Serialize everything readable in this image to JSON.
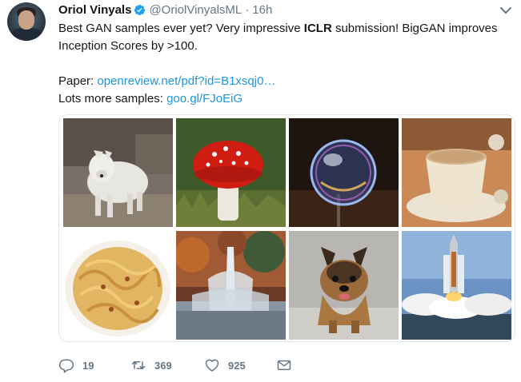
{
  "tweet": {
    "author_name": "Oriol Vinyals",
    "author_handle": "@OriolVinyalsML",
    "separator": "·",
    "time": "16h",
    "text_before_bold": "Best GAN samples ever yet? Very impressive ",
    "text_bold": "ICLR",
    "text_after_bold": " submission! BigGAN improves",
    "text_line2": "Inception Scores by >100.",
    "paper_label": "Paper: ",
    "paper_link": "openreview.net/pdf?id=B1xsqj0…",
    "samples_label": "Lots more samples: ",
    "samples_link": "goo.gl/FJoEiG"
  },
  "media": {
    "images": [
      {
        "subject": "white wolf"
      },
      {
        "subject": "red fly agaric mushroom"
      },
      {
        "subject": "soap bubble"
      },
      {
        "subject": "cup of coffee"
      },
      {
        "subject": "plate of pasta"
      },
      {
        "subject": "fountain"
      },
      {
        "subject": "yorkshire terrier"
      },
      {
        "subject": "space shuttle launch"
      }
    ]
  },
  "actions": {
    "reply_icon": "reply-icon",
    "reply_count": "19",
    "retweet_icon": "retweet-icon",
    "retweet_count": "369",
    "like_icon": "heart-icon",
    "like_count": "925",
    "dm_icon": "envelope-icon"
  },
  "colors": {
    "link": "#1b95e0",
    "secondary_text": "#657786",
    "verified": "#1da1f2"
  }
}
